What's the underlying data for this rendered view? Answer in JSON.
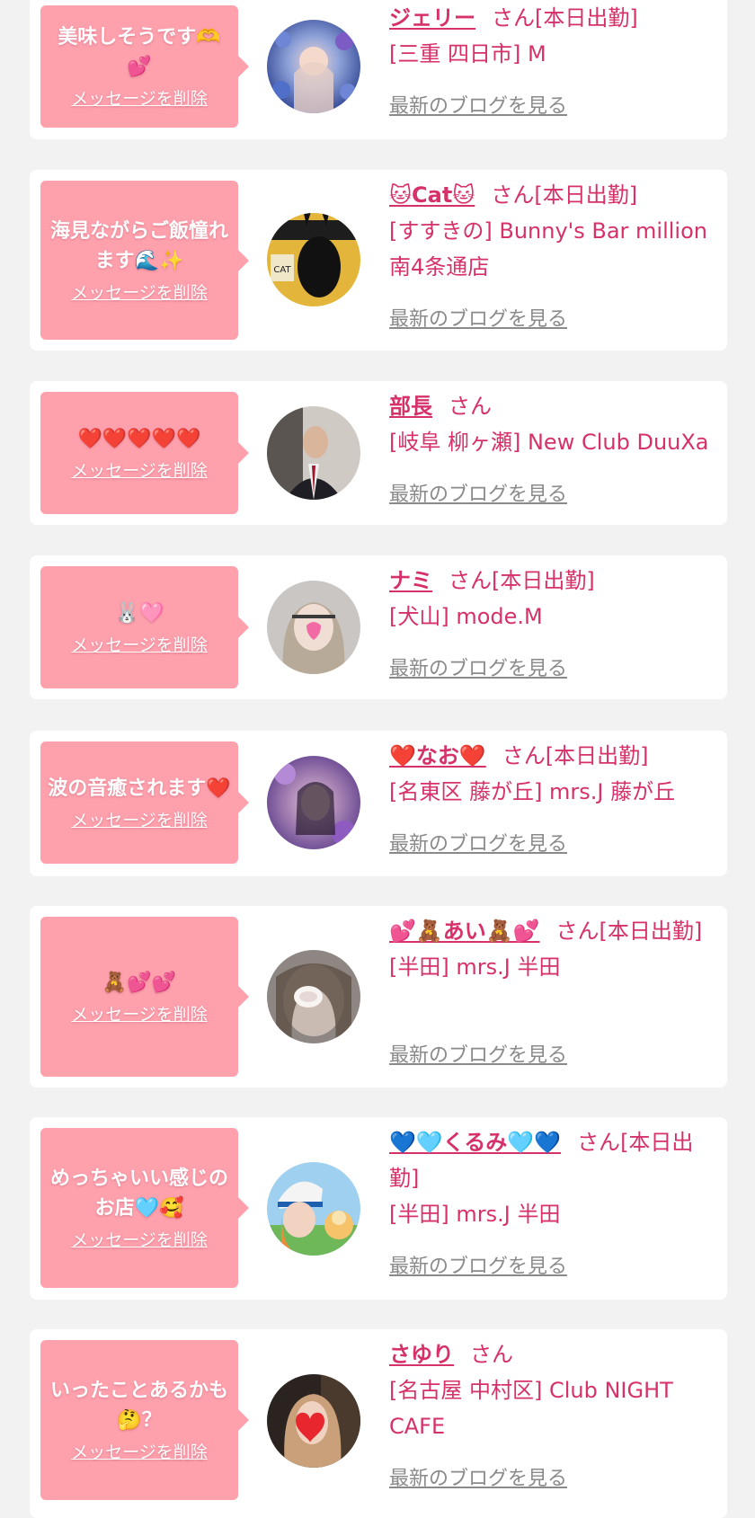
{
  "delete_label": "メッセージを削除",
  "blog_label": "最新のブログを見る",
  "colors": {
    "pink_bubble": "#ffa0ad",
    "accent": "#d6316a",
    "link_gray": "#8a8a8a",
    "bg": "#f2f2f2"
  },
  "entries": [
    {
      "message": "美味しそうです🫶💕",
      "name": "ジェリー",
      "honorific": "さん",
      "status": "[本日出勤]",
      "shop": "[三重 四日市] M",
      "avatar_icon": "flower-bouquet-photo"
    },
    {
      "message": "海見ながらご飯憧れます🌊✨",
      "name": "🐱Cat🐱",
      "honorific": "さん",
      "status": "[本日出勤]",
      "shop": "[すすきの] Bunny's Bar million 南4条通店",
      "avatar_icon": "bunny-girl-photo"
    },
    {
      "message": "❤️❤️❤️❤️❤️",
      "name": "部長",
      "honorific": "さん",
      "status": "",
      "shop": "[岐阜 柳ヶ瀬] New Club DuuXa",
      "avatar_icon": "suit-man-photo"
    },
    {
      "message": "🐰🩷",
      "name": "ナミ",
      "honorific": "さん",
      "status": "[本日出勤]",
      "shop": "[犬山] mode.M",
      "avatar_icon": "girl-heart-sticker-photo"
    },
    {
      "message": "波の音癒されます❤️",
      "name": "❤️なお❤️",
      "honorific": "さん",
      "status": "[本日出勤]",
      "shop": "[名東区 藤が丘] mrs.J 藤が丘",
      "avatar_icon": "purple-flower-photo"
    },
    {
      "message": "🧸💕💕",
      "name": "💕🧸あい🧸💕",
      "honorific": "さん",
      "status": "[本日出勤]",
      "shop": "[半田] mrs.J 半田",
      "avatar_icon": "blurred-girl-photo"
    },
    {
      "message": "めっちゃいい感じのお店🩵🥰",
      "name": "💙🩵くるみ🩵💙",
      "honorific": "さん",
      "status": "[本日出勤]",
      "shop": "[半田] mrs.J 半田",
      "avatar_icon": "girl-cap-photo"
    },
    {
      "message": "いったことあるかも🤔？",
      "name": "さゆり",
      "honorific": "さん",
      "status": "",
      "shop": "[名古屋 中村区] Club NIGHT CAFE",
      "avatar_icon": "girl-heart-face-photo"
    }
  ]
}
